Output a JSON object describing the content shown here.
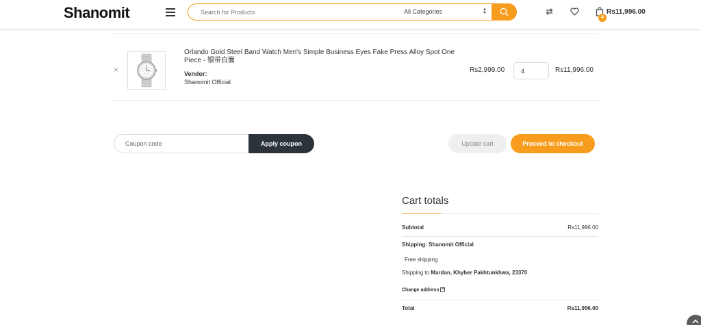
{
  "header": {
    "logo": "Shanomit",
    "search_placeholder": "Search for Products",
    "category": "All Categories",
    "cart_count": "4",
    "cart_total": "Rs11,996.00"
  },
  "cart": {
    "item": {
      "remove": "×",
      "name": "Orlando Gold Steel Band Watch Men's Simple Business Eyes Fake Press Alloy Spot One Piece - 银带白面",
      "vendor_label": "Vendor:",
      "vendor_name": "Shanomit Official",
      "price": "Rs2,999.00",
      "quantity": "4",
      "subtotal": "Rs11,996.00"
    },
    "coupon_placeholder": "Coupon code",
    "apply_label": "Apply coupon",
    "update_label": "Update cart",
    "checkout_label": "Proceed to checkout"
  },
  "totals": {
    "title": "Cart totals",
    "subtotal_label": "Subtotal",
    "subtotal_value": "Rs11,996.00",
    "shipping_label": "Shipping: Shanomit Official",
    "free_shipping": "Free shipping",
    "shipping_to": "Shipping to",
    "shipping_address": "Mardan, Khyber Pakhtunkhwa, 23370",
    "change_address": "Change address",
    "total_label": "Total",
    "total_value": "Rs11,996.00"
  },
  "colors": {
    "accent": "#f79c1d",
    "dark_button": "#2d333a"
  }
}
